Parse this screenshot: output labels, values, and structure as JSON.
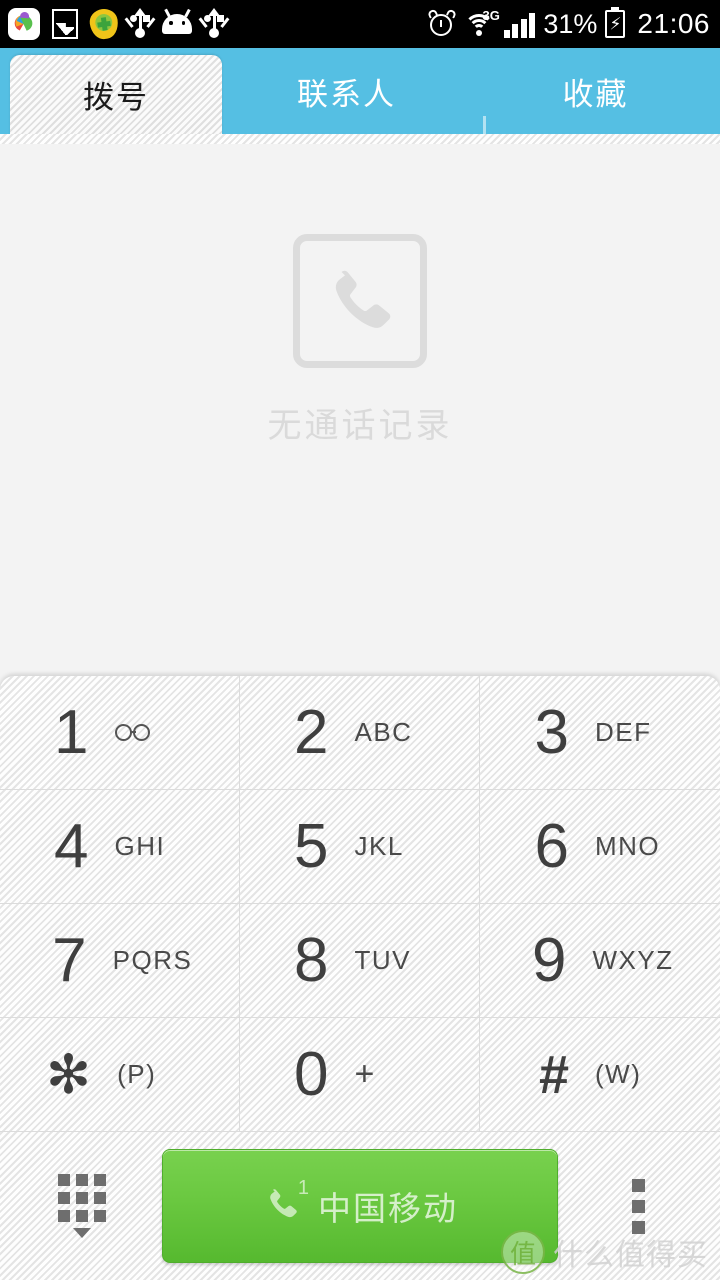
{
  "status_bar": {
    "icons": [
      "app-360-icon",
      "photo-icon",
      "shield-icon",
      "usb-icon",
      "android-icon",
      "usb-icon",
      "alarm-icon",
      "wifi-icon"
    ],
    "network_type": "3G",
    "battery_percent": "31%",
    "battery_state": "charging",
    "time": "21:06"
  },
  "tabs": [
    {
      "label": "拨号",
      "name": "tab-dialer",
      "active": true
    },
    {
      "label": "联系人",
      "name": "tab-contacts",
      "active": false
    },
    {
      "label": "收藏",
      "name": "tab-favorites",
      "active": false
    }
  ],
  "call_log": {
    "empty_icon": "phone-handset-icon",
    "empty_text": "无通话记录"
  },
  "keypad": {
    "keys": [
      {
        "digit": "1",
        "sub": "",
        "icon": "voicemail-icon",
        "name": "key-1"
      },
      {
        "digit": "2",
        "sub": "ABC",
        "icon": "",
        "name": "key-2"
      },
      {
        "digit": "3",
        "sub": "DEF",
        "icon": "",
        "name": "key-3"
      },
      {
        "digit": "4",
        "sub": "GHI",
        "icon": "",
        "name": "key-4"
      },
      {
        "digit": "5",
        "sub": "JKL",
        "icon": "",
        "name": "key-5"
      },
      {
        "digit": "6",
        "sub": "MNO",
        "icon": "",
        "name": "key-6"
      },
      {
        "digit": "7",
        "sub": "PQRS",
        "icon": "",
        "name": "key-7"
      },
      {
        "digit": "8",
        "sub": "TUV",
        "icon": "",
        "name": "key-8"
      },
      {
        "digit": "9",
        "sub": "WXYZ",
        "icon": "",
        "name": "key-9"
      },
      {
        "digit": "✻",
        "sub": "(P)",
        "icon": "",
        "name": "key-star"
      },
      {
        "digit": "0",
        "sub": "+",
        "icon": "",
        "name": "key-0"
      },
      {
        "digit": "#",
        "sub": "(W)",
        "icon": "",
        "name": "key-hash"
      }
    ]
  },
  "action_bar": {
    "keypad_toggle": "dialpad-hide-icon",
    "call_button": {
      "label": "中国移动",
      "icon": "phone-call-icon",
      "sim_badge": "1",
      "color": "#6ac840"
    },
    "overflow": "more-vertical-icon"
  },
  "watermark": {
    "logo": "值",
    "text": "什么值得买"
  },
  "colors": {
    "tab_bar": "#55bfe3",
    "call_button": "#6ac840",
    "content_bg": "#f3f3f3",
    "key_text": "#3f3f3f",
    "empty_text": "#dadada"
  }
}
